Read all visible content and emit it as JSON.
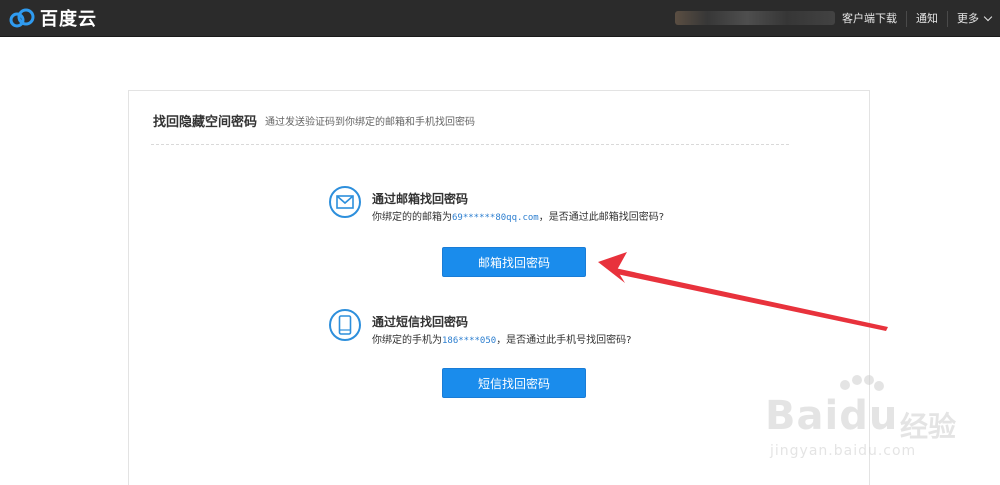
{
  "header": {
    "brand": "百度云",
    "nav": [
      {
        "label": "客户端下载"
      },
      {
        "label": "通知"
      },
      {
        "label": "更多"
      }
    ]
  },
  "panel": {
    "title": "找回隐藏空间密码",
    "subtitle": "通过发送验证码到你绑定的邮箱和手机找回密码"
  },
  "email_option": {
    "title": "通过邮箱找回密码",
    "desc_prefix": "你绑定的的邮箱为",
    "masked_value": "69******80qq.com",
    "desc_suffix": "，是否通过此邮箱找回密码?",
    "button": "邮箱找回密码",
    "icon": "envelope-icon"
  },
  "sms_option": {
    "title": "通过短信找回密码",
    "desc_prefix": "你绑定的手机为",
    "masked_value": "186****050",
    "desc_suffix": "，是否通过此手机号找回密码?",
    "button": "短信找回密码",
    "icon": "phone-icon"
  },
  "watermark": {
    "main": "Bai",
    "main_end": "du",
    "cn": "经验",
    "url": "jingyan.baidu.com"
  },
  "colors": {
    "topbar": "#2b2b2b",
    "accent": "#1a8cec",
    "arrow": "#e8323c"
  }
}
